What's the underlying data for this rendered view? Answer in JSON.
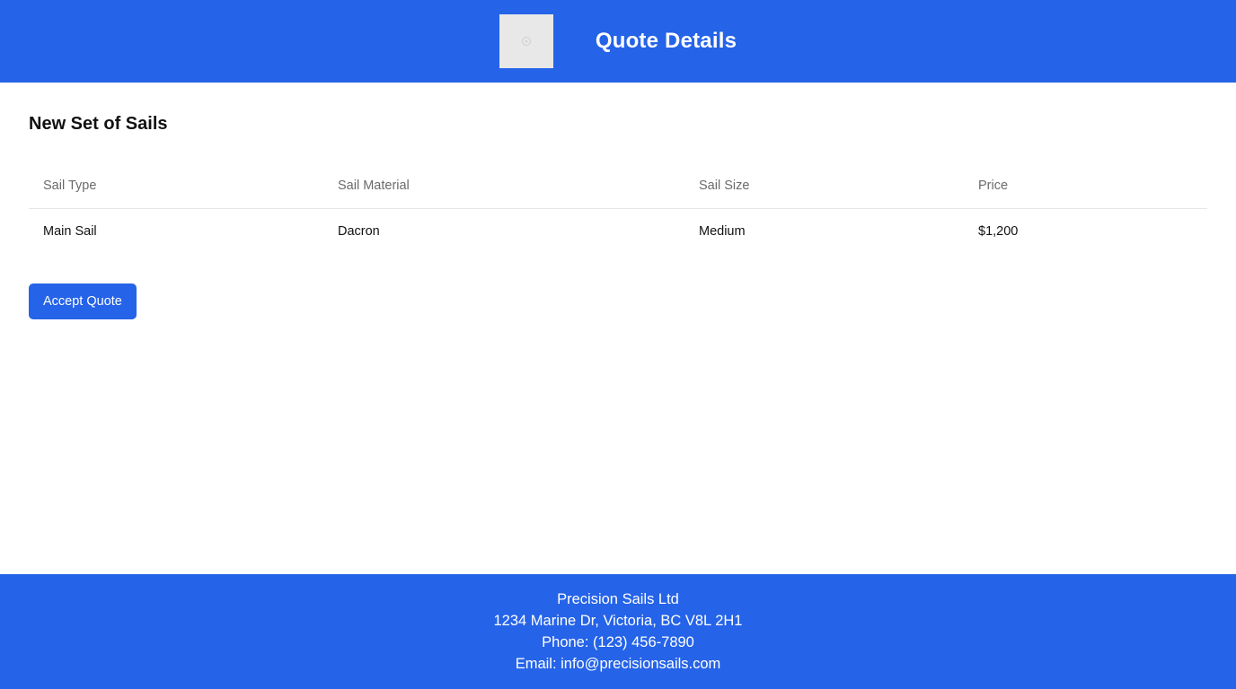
{
  "header": {
    "logo_icon": "image-placeholder-icon",
    "title": "Quote Details"
  },
  "main": {
    "section_title": "New Set of Sails",
    "table": {
      "columns": [
        "Sail Type",
        "Sail Material",
        "Sail Size",
        "Price"
      ],
      "rows": [
        [
          "Main Sail",
          "Dacron",
          "Medium",
          "$1,200"
        ]
      ]
    },
    "accept_label": "Accept Quote"
  },
  "footer": {
    "company": "Precision Sails Ltd",
    "address": "1234 Marine Dr, Victoria, BC V8L 2H1",
    "phone": "Phone: (123) 456-7890",
    "email": "Email: info@precisionsails.com"
  },
  "colors": {
    "brand_blue": "#2563e8",
    "placeholder_gray": "#e8e8e8"
  }
}
